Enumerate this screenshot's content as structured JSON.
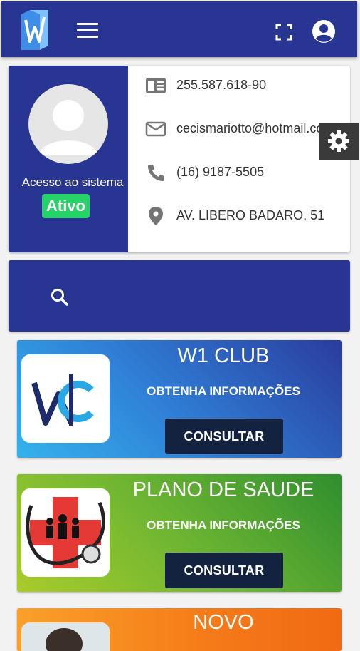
{
  "header": {
    "logo_icon": "w-logo-icon",
    "menu_icon": "hamburger-menu-icon",
    "fullscreen_icon": "fullscreen-icon",
    "account_icon": "account-circle-icon",
    "bg_color": "#283593"
  },
  "profile": {
    "avatar_icon": "user-avatar-icon",
    "access_label": "Acesso ao sistema",
    "status": "Ativo",
    "status_color": "#25d366",
    "document": {
      "icon": "id-card-icon",
      "value": "255.587.618-90"
    },
    "email": {
      "icon": "mail-icon",
      "value": "cecismariotto@hotmail.co"
    },
    "phone": {
      "icon": "phone-icon",
      "value": "(16) 9187-5505"
    },
    "address": {
      "icon": "location-pin-icon",
      "value": "AV. LIBERO BADARO, 51"
    }
  },
  "settings": {
    "icon": "gear-icon"
  },
  "search": {
    "icon": "search-icon",
    "placeholder": ""
  },
  "cards": [
    {
      "title": "W1 CLUB",
      "subtitle": "OBTENHA INFORMAÇÕES",
      "button_label": "CONSULTAR",
      "image_icon": "w1-club-logo"
    },
    {
      "title": "PLANO DE SAUDE",
      "subtitle": "OBTENHA INFORMAÇÕES",
      "button_label": "CONSULTAR",
      "image_icon": "health-plan-family-stethoscope-icon"
    },
    {
      "title": "NOVO",
      "image_icon": "person-photo"
    }
  ]
}
